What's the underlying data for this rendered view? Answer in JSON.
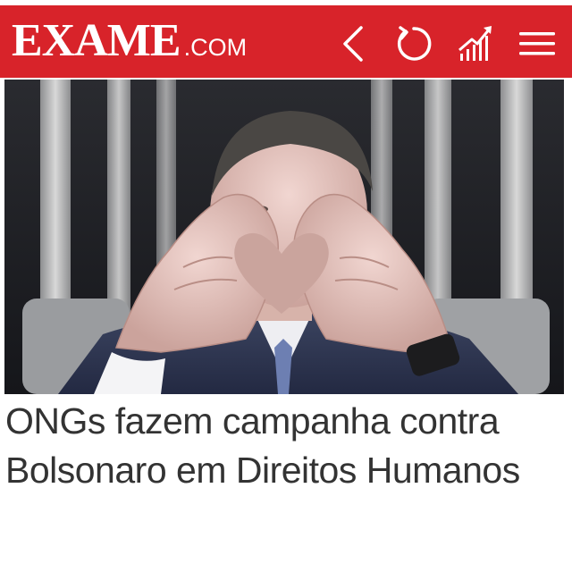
{
  "header": {
    "logo_main": "EXAME",
    "logo_suffix": ".COM",
    "brand_color": "#d8232a",
    "icons": [
      "back-icon",
      "refresh-icon",
      "signal-chart-icon",
      "menu-icon"
    ]
  },
  "article": {
    "photo_description_icon": "photo-heart-hands",
    "headline": "ONGs fazem campanha contra Bolsonaro em Direitos Humanos"
  }
}
